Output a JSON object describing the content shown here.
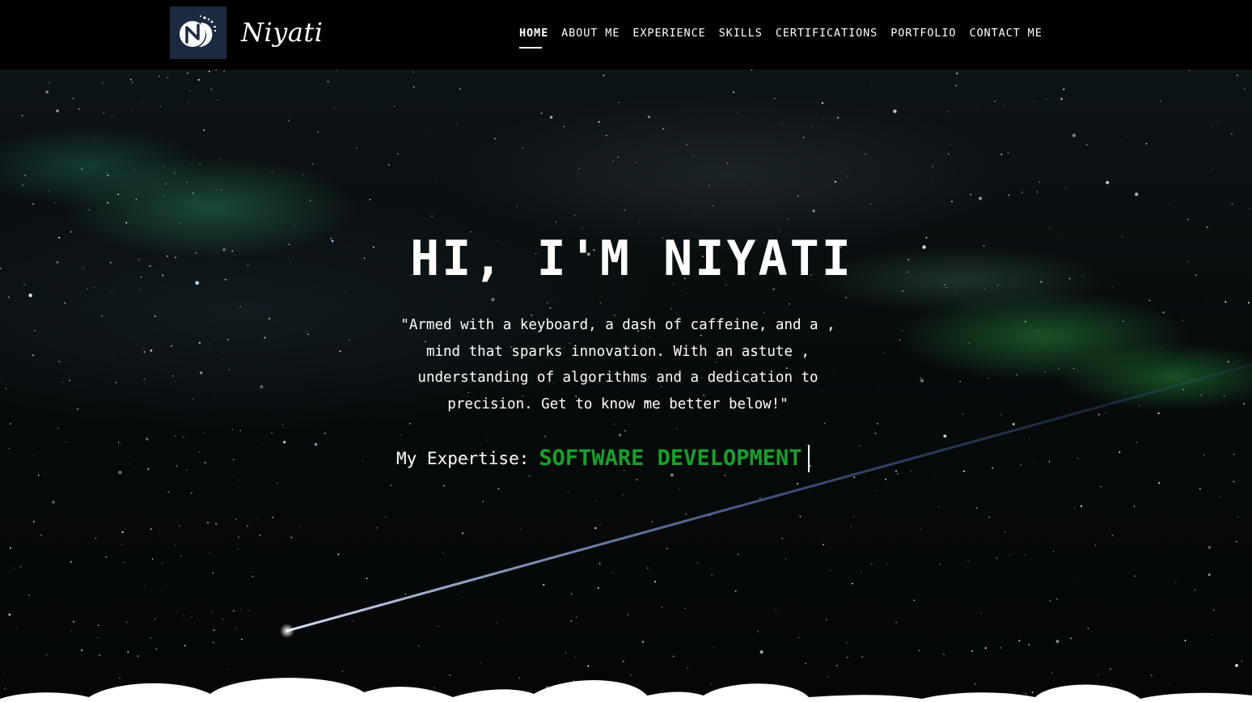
{
  "brand": {
    "name": "Niyati",
    "logo_icon": "stylized-n-logo-icon"
  },
  "nav": {
    "items": [
      {
        "label": "HOME",
        "active": true
      },
      {
        "label": "ABOUT ME",
        "active": false
      },
      {
        "label": "EXPERIENCE",
        "active": false
      },
      {
        "label": "SKILLS",
        "active": false
      },
      {
        "label": "CERTIFICATIONS",
        "active": false
      },
      {
        "label": "PORTFOLIO",
        "active": false
      },
      {
        "label": "CONTACT ME",
        "active": false
      }
    ]
  },
  "hero": {
    "title": "HI, I'M NIYATI",
    "quote_lines": [
      "\"Armed with a keyboard, a dash of caffeine, and a ,",
      "mind that sparks innovation. With an astute ,",
      "understanding of algorithms and a dedication to",
      "precision. Get to know me better below!\""
    ],
    "expertise_label": "My Expertise:",
    "expertise_value": "SOFTWARE DEVELOPMENT"
  },
  "colors": {
    "background": "#000000",
    "accent_green": "#1a9f2c",
    "logo_badge": "#1b2a40",
    "text": "#ffffff"
  }
}
